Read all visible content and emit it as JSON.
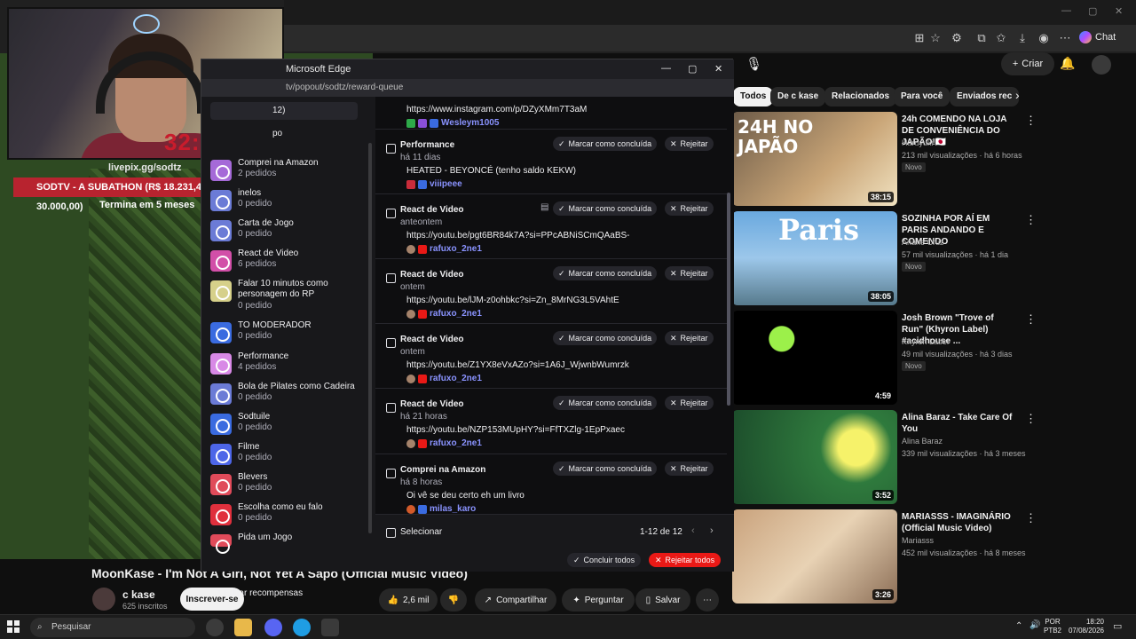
{
  "browser": {
    "chat_label": "Chat"
  },
  "stream": {
    "timer": "32:29:16",
    "livepix": "livepix.gg/sodtz",
    "subathon": "SODTV - A SUBATHON (R$ 18.231,46/R$ 30.000,00)",
    "ends": "Termina em 5 meses"
  },
  "youtube": {
    "video_title": "MoonKase - I'm Not A Girl, Not Yet A Sapo (Official Music Video)",
    "channel_name": "c kase",
    "channel_subs": "625 inscritos",
    "subscribe_label": "Inscrever-se",
    "likes": "2,6 mil",
    "share_label": "Compartilhar",
    "ask_label": "Perguntar",
    "save_label": "Salvar",
    "create_label": "Criar",
    "chips": [
      "Todos",
      "De c kase",
      "Relacionados",
      "Para você",
      "Enviados rec"
    ],
    "recommendations": [
      {
        "title": "24h COMENDO NA LOJA DE CONVENIÊNCIA DO JAPÃO!🇯🇵",
        "channel": "Haruyuki",
        "meta": "213 mil visualizações · há 6 horas",
        "badge": "Novo",
        "duration": "38:15",
        "thumb_text": "24H NO JAPÃO"
      },
      {
        "title": "SOZINHA POR AÍ EM PARIS ANDANDO E COMENDO",
        "channel": "Ariane Cruz",
        "meta": "57 mil visualizações · há 1 dia",
        "badge": "Novo",
        "duration": "38:05",
        "thumb_text": "Paris"
      },
      {
        "title": "Josh Brown \"Trove of Run\" (Khyron Label) #acidhouse ...",
        "channel": "Khyron Label",
        "meta": "49 mil visualizações · há 3 dias",
        "badge": "Novo",
        "duration": "4:59",
        "thumb_text": ""
      },
      {
        "title": "Alina Baraz - Take Care Of You",
        "channel": "Alina Baraz",
        "meta": "339 mil visualizações · há 3 meses",
        "badge": "",
        "duration": "3:52",
        "thumb_text": ""
      },
      {
        "title": "MARIASSS - IMAGINÁRIO (Official Music Video)",
        "channel": "Mariasss",
        "meta": "452 mil visualizações · há 8 meses",
        "badge": "",
        "duration": "3:26",
        "thumb_text": ""
      }
    ]
  },
  "popout": {
    "window_title": "Microsoft Edge",
    "url": "tv/popout/sodtz/reward-queue",
    "sidebar": [
      {
        "name": "12)",
        "count": "",
        "color": "#4b4b57"
      },
      {
        "name": "po",
        "count": "",
        "color": "#4b4b57"
      },
      {
        "name": "Comprei na Amazon",
        "count": "2 pedidos",
        "color": "#a56ad8"
      },
      {
        "name": "inelos",
        "count": "0 pedido",
        "color": "#6b7bd6"
      },
      {
        "name": "Carta de Jogo",
        "count": "0 pedido",
        "color": "#6b7bd6"
      },
      {
        "name": "React de Video",
        "count": "6 pedidos",
        "color": "#d24fa8"
      },
      {
        "name": "Falar 10 minutos como personagem do RP",
        "count": "0 pedido",
        "color": "#d6d08a"
      },
      {
        "name": "TO MODERADOR",
        "count": "0 pedido",
        "color": "#3a6be0"
      },
      {
        "name": "Performance",
        "count": "4 pedidos",
        "color": "#d889e6"
      },
      {
        "name": "Bola de Pilates como Cadeira",
        "count": "0 pedido",
        "color": "#6b7bd6"
      },
      {
        "name": "Sodtuile",
        "count": "0 pedido",
        "color": "#3a6be0"
      },
      {
        "name": "Filme",
        "count": "0 pedido",
        "color": "#4d66e8"
      },
      {
        "name": "Blevers",
        "count": "0 pedido",
        "color": "#e04b5a"
      },
      {
        "name": "Escolha como eu falo",
        "count": "0 pedido",
        "color": "#e0303d"
      },
      {
        "name": "Pida um Jogo",
        "count": "",
        "color": "#e04b5a"
      }
    ],
    "edit_rewards": "Editar recompensas",
    "queue_top": {
      "msg": "https://www.instagram.com/p/DZyXMm7T3aM",
      "user": "Wesleym1005"
    },
    "queue": [
      {
        "reward": "Performance",
        "time": "há 11 dias",
        "msg": "HEATED - BEYONCÉ (tenho saldo KEKW)",
        "user": "viiipeee"
      },
      {
        "reward": "React de Video",
        "time": "anteontem",
        "msg": "https://youtu.be/pgt6BR84k7A?si=PPcABNiSCmQAaBS-",
        "user": "rafuxo_2ne1"
      },
      {
        "reward": "React de Video",
        "time": "ontem",
        "msg": "https://youtu.be/lJM-z0ohbkc?si=Zn_8MrNG3L5VAhtE",
        "user": "rafuxo_2ne1"
      },
      {
        "reward": "React de Video",
        "time": "ontem",
        "msg": "https://youtu.be/Z1YX8eVxAZo?si=1A6J_WjwnbWumrzk",
        "user": "rafuxo_2ne1"
      },
      {
        "reward": "React de Video",
        "time": "há 21 horas",
        "msg": "https://youtu.be/NZP153MUpHY?si=FfTXZlg-1EpPxaec",
        "user": "rafuxo_2ne1"
      },
      {
        "reward": "Comprei na Amazon",
        "time": "há 8 horas",
        "msg": "Oi vê se deu certo eh um livro",
        "user": "milas_karo"
      }
    ],
    "complete_label": "Marcar como concluída",
    "reject_label": "Rejeitar",
    "select_label": "Selecionar",
    "pagination": "1-12 de 12",
    "complete_all": "Concluir todos",
    "reject_all": "Rejeitar todos"
  },
  "taskbar": {
    "search_placeholder": "Pesquisar",
    "lang": "POR",
    "layout": "PTB2",
    "time": "18:20",
    "date": "07/08/2026"
  }
}
